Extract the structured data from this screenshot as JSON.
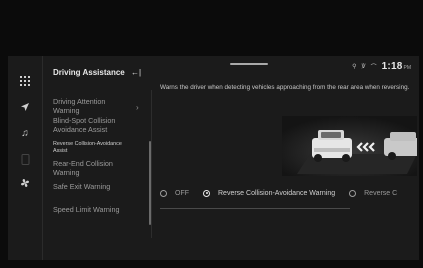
{
  "status_bar": {
    "time": "1:18",
    "ampm": "PM"
  },
  "sidebar_icons": [
    {
      "name": "apps-grid-icon"
    },
    {
      "name": "navigation-arrow-icon"
    },
    {
      "name": "music-note-icon"
    },
    {
      "name": "phone-mirroring-icon"
    },
    {
      "name": "fan-climate-icon"
    }
  ],
  "menu": {
    "title": "Driving Assistance",
    "back_glyph": "←|",
    "items": [
      {
        "label": "Driving Attention Warning"
      },
      {
        "label": "Blind-Spot Collision Avoidance Assist"
      },
      {
        "label": "Reverse Collision-Avoidance Assist"
      },
      {
        "label": "Rear-End Collision Warning"
      },
      {
        "label": "Safe Exit Warning"
      },
      {
        "label": "Speed Limit Warning"
      }
    ]
  },
  "content": {
    "description": "Warns the driver when detecting vehicles approaching from the rear area when reversing.",
    "options": [
      {
        "label": "OFF",
        "selected": false
      },
      {
        "label": "Reverse Collision-Avoidance Warning",
        "selected": true
      },
      {
        "label": "Reverse C",
        "selected": false
      }
    ]
  }
}
